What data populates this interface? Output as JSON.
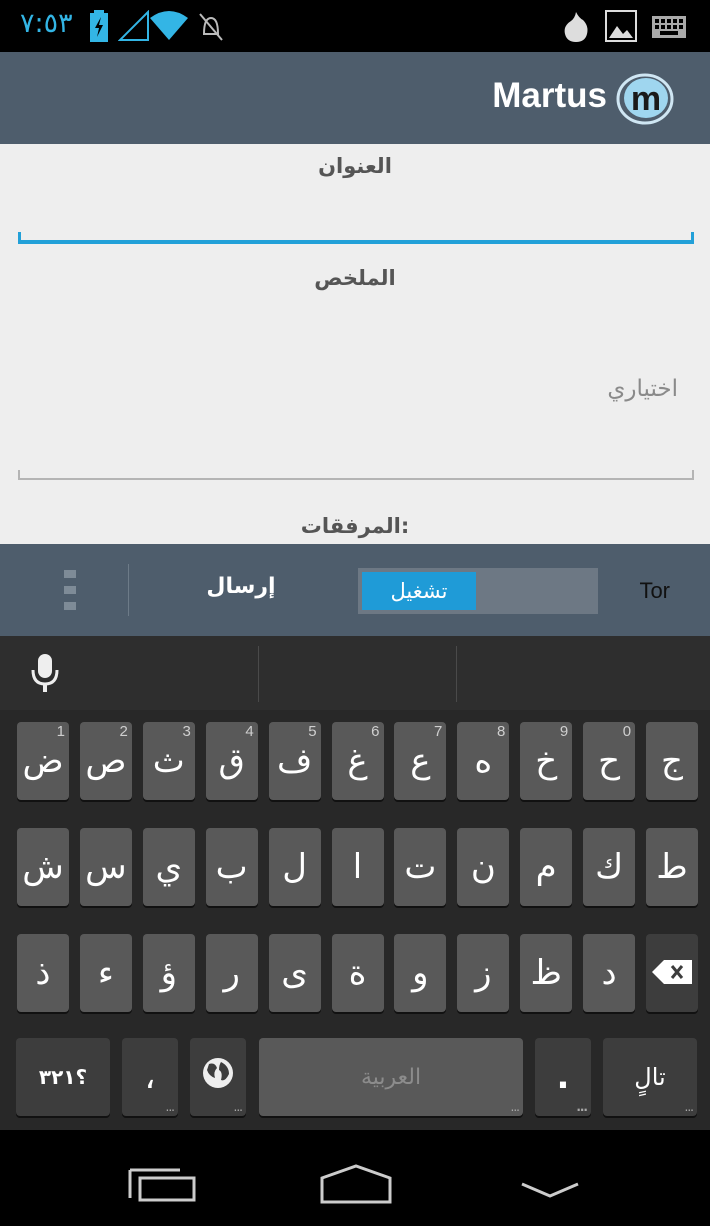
{
  "status_bar": {
    "time": "٧:٥٣",
    "icons": [
      "battery-charging-icon",
      "signal-icon",
      "wifi-icon",
      "mute-icon",
      "tor-onion-icon",
      "image-icon",
      "keyboard-icon"
    ],
    "accent_color": "#33b5e5"
  },
  "action_bar": {
    "title": "Martus",
    "logo_icon": "martus-logo-icon",
    "background": "#4e5d6c"
  },
  "form": {
    "title_label": "العنوان",
    "title_value": "",
    "summary_label": "الملخص",
    "summary_placeholder": "اختياري",
    "attachments_label": "المرفقات:"
  },
  "action_strip": {
    "tor_label": "Tor",
    "tor_toggle_label": "تشغيل",
    "send_label": "إرسال",
    "overflow_icon": "overflow-menu-icon"
  },
  "keyboard": {
    "row1": [
      {
        "char": "ض",
        "hint": "1"
      },
      {
        "char": "ص",
        "hint": "2"
      },
      {
        "char": "ث",
        "hint": "3"
      },
      {
        "char": "ق",
        "hint": "4"
      },
      {
        "char": "ف",
        "hint": "5"
      },
      {
        "char": "غ",
        "hint": "6"
      },
      {
        "char": "ع",
        "hint": "7"
      },
      {
        "char": "ه",
        "hint": "8"
      },
      {
        "char": "خ",
        "hint": "9"
      },
      {
        "char": "ح",
        "hint": "0"
      },
      {
        "char": "ج",
        "hint": ""
      }
    ],
    "row2": [
      "ش",
      "س",
      "ي",
      "ب",
      "ل",
      "ا",
      "ت",
      "ن",
      "م",
      "ك",
      "ط"
    ],
    "row3": [
      "ذ",
      "ء",
      "ؤ",
      "ر",
      "ى",
      "ة",
      "و",
      "ز",
      "ظ",
      "د"
    ],
    "symbols_key": "؟٣٢١",
    "comma_key": "،",
    "space_label": "العربية",
    "period_key": ".",
    "enter_label": "تالٍ",
    "mic_icon": "microphone-icon",
    "globe_icon": "globe-icon",
    "backspace_icon": "backspace-icon"
  },
  "nav_bar": {
    "icons": [
      "recent-apps-icon",
      "home-icon",
      "hide-keyboard-icon"
    ]
  }
}
